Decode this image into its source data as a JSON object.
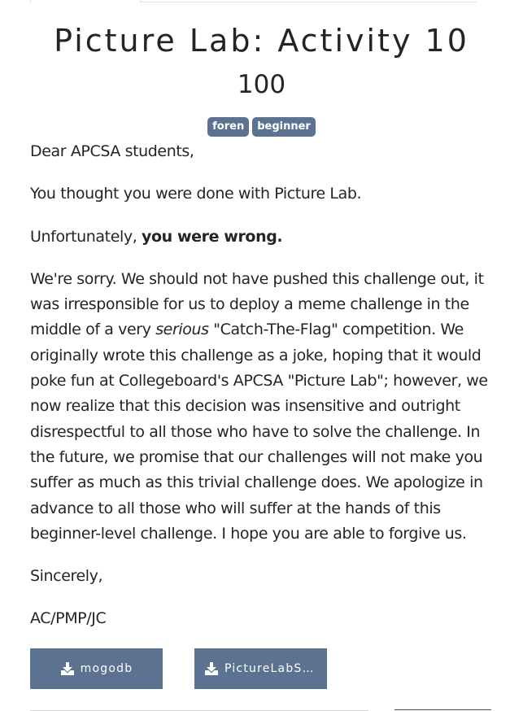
{
  "challenge": {
    "name": "Picture Lab: Activity 10",
    "value": "100",
    "tags": [
      "foren",
      "beginner"
    ]
  },
  "description": {
    "greeting": "Dear APCSA students,",
    "line2": "You thought you were done with Picture Lab.",
    "line3_prefix": "Unfortunately, ",
    "line3_bold": "you were wrong.",
    "para4_a": "We're sorry. We should not have pushed this challenge out, it was irresponsible for us to deploy a meme challenge in the middle of a very ",
    "para4_italic": "serious",
    "para4_b": " \"Catch-The-Flag\" competition. We originally wrote this challenge as a joke, hoping that it would poke fun at Collegeboard's APCSA \"Picture Lab\"; however, we now realize that this decision was insensitive and outright disrespectful to all those who have to solve the challenge. In the future, we promise that our challenges will not make you suffer as much as this trivial challenge does. We apologize in advance to all those who will suffer at the hands of this beginner-level challenge. I hope you are able to forgive us.",
    "closing": "Sincerely,",
    "signature": "AC/PMP/JC"
  },
  "files": [
    {
      "label": "mogodb",
      "icon": "download-icon"
    },
    {
      "label": "PictureLabSt…",
      "icon": "download-icon"
    }
  ],
  "colors": {
    "tag_bg": "#5b7290",
    "button_bg": "#5b7290",
    "text": "#212529"
  }
}
